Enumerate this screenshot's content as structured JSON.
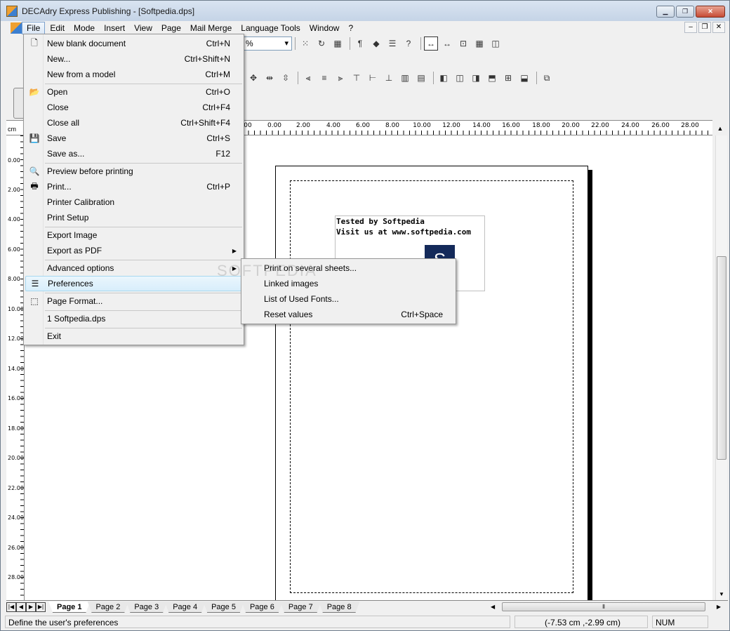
{
  "window": {
    "title": "DECAdry Express Publishing - [Softpedia.dps]"
  },
  "menubar": {
    "items": [
      "File",
      "Edit",
      "Mode",
      "Insert",
      "View",
      "Page",
      "Mail Merge",
      "Language Tools",
      "Window",
      "?"
    ],
    "active": "File"
  },
  "toolbar": {
    "zoom_value": "%"
  },
  "ruler": {
    "unit": "cm",
    "h_labels": [
      "00",
      "0.00",
      "2.00",
      "4.00",
      "6.00",
      "8.00",
      "10.00",
      "12.00",
      "14.00",
      "16.00",
      "18.00",
      "20.00",
      "22.00",
      "24.00",
      "26.00",
      "28.00"
    ],
    "v_labels": [
      "0.00",
      "2.00",
      "4.00",
      "6.00",
      "8.00",
      "10.00",
      "12.00",
      "14.00",
      "16.00",
      "18.00",
      "20.00",
      "22.00",
      "24.00",
      "26.00",
      "28.00"
    ]
  },
  "document": {
    "line1": "Tested by Softpedia",
    "line2": "Visit us at www.softpedia.com",
    "logo_letter": "S",
    "logo_color": "#142a5a"
  },
  "file_menu": {
    "items": [
      {
        "label": "New blank document",
        "shortcut": "Ctrl+N",
        "icon": "blank-page-icon"
      },
      {
        "label": "New...",
        "shortcut": "Ctrl+Shift+N"
      },
      {
        "label": "New from a model",
        "shortcut": "Ctrl+M"
      },
      {
        "label": "Open",
        "shortcut": "Ctrl+O",
        "icon": "open-folder-icon"
      },
      {
        "label": "Close",
        "shortcut": "Ctrl+F4"
      },
      {
        "label": "Close all",
        "shortcut": "Ctrl+Shift+F4"
      },
      {
        "label": "Save",
        "shortcut": "Ctrl+S",
        "icon": "floppy-icon"
      },
      {
        "label": "Save as...",
        "shortcut": "F12"
      },
      {
        "label": "Preview before printing",
        "shortcut": "",
        "icon": "print-preview-icon"
      },
      {
        "label": "Print...",
        "shortcut": "Ctrl+P",
        "icon": "printer-icon"
      },
      {
        "label": "Printer Calibration",
        "shortcut": ""
      },
      {
        "label": "Print Setup",
        "shortcut": ""
      },
      {
        "label": "Export Image",
        "shortcut": ""
      },
      {
        "label": "Export as PDF",
        "shortcut": ""
      },
      {
        "label": "Advanced options",
        "shortcut": ""
      },
      {
        "label": "Preferences",
        "shortcut": "",
        "icon": "preferences-icon"
      },
      {
        "label": "Page Format...",
        "shortcut": "",
        "icon": "page-format-icon"
      },
      {
        "label": "1 Softpedia.dps",
        "shortcut": ""
      },
      {
        "label": "Exit",
        "shortcut": ""
      }
    ],
    "highlighted": "Preferences"
  },
  "submenu": {
    "items": [
      {
        "label": "Print on several sheets...",
        "shortcut": ""
      },
      {
        "label": "Linked images",
        "shortcut": ""
      },
      {
        "label": "List of Used Fonts...",
        "shortcut": ""
      },
      {
        "label": "Reset values",
        "shortcut": "Ctrl+Space"
      }
    ]
  },
  "page_tabs": [
    "Page 1",
    "Page 2",
    "Page 3",
    "Page 4",
    "Page 5",
    "Page 6",
    "Page 7",
    "Page 8"
  ],
  "status": {
    "message": "Define the user's preferences",
    "coords": "(-7.53 cm ,-2.99 cm)",
    "num": "NUM"
  },
  "watermark": "SOFTPEDIA"
}
